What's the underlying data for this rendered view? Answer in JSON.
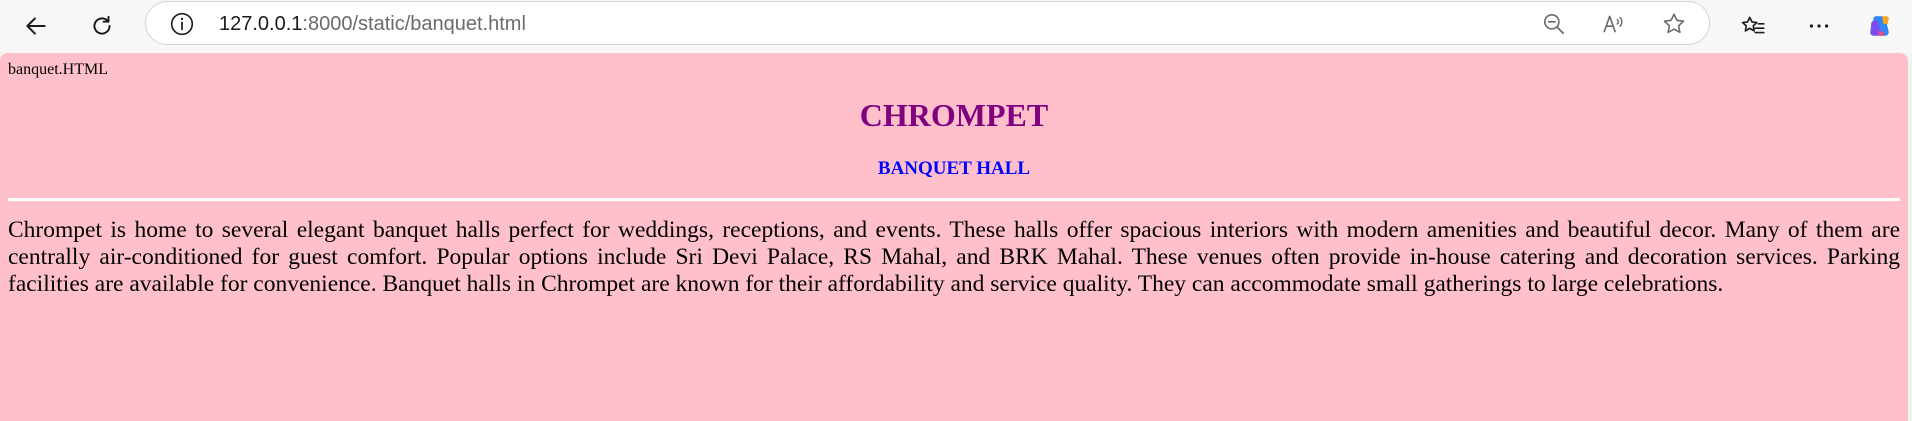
{
  "browser": {
    "url_host": "127.0.0.1",
    "url_rest": ":8000/static/banquet.html",
    "icons": {
      "back": "back-arrow-icon",
      "refresh": "refresh-icon",
      "site_info": "info-icon",
      "zoom": "zoom-out-icon",
      "read_aloud": "read-aloud-icon",
      "favorite": "star-icon",
      "favorites": "favorites-icon",
      "more": "more-icon",
      "copilot": "copilot-icon"
    }
  },
  "page": {
    "label": "banquet.HTML",
    "title": "CHROMPET",
    "subtitle": "BANQUET HALL",
    "paragraph": "Chrompet is home to several elegant banquet halls perfect for weddings, receptions, and events. These halls offer spacious interiors with modern amenities and beautiful decor. Many of them are centrally air-conditioned for guest comfort. Popular options include Sri Devi Palace, RS Mahal, and BRK Mahal. These venues often provide in-house catering and decoration services. Parking facilities are available for convenience. Banquet halls in Chrompet are known for their affordability and service quality. They can accommodate small gatherings to large celebrations.",
    "colors": {
      "background": "#ffc0cb",
      "title": "#800080",
      "subtitle": "#0000ff",
      "divider": "#ffffff"
    }
  }
}
